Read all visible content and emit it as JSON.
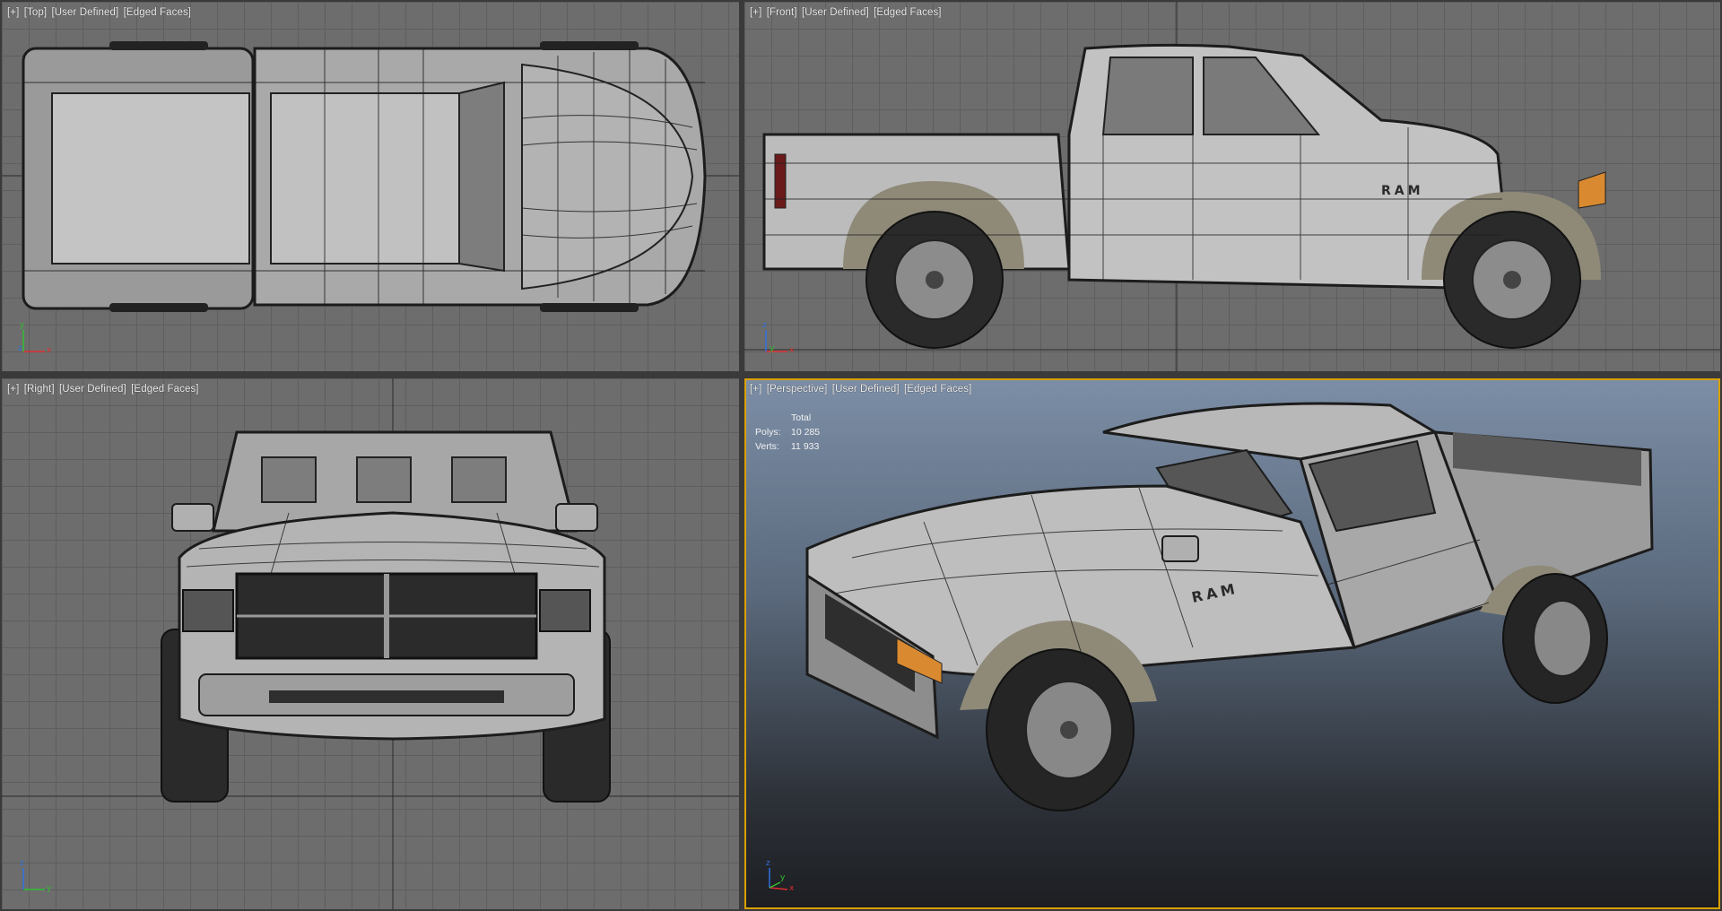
{
  "viewports": {
    "top": {
      "labels": [
        "[+]",
        "[Top]",
        "[User Defined]",
        "[Edged Faces]"
      ],
      "axis": {
        "horizontal": "x",
        "vertical": "y",
        "depth": "z"
      }
    },
    "front": {
      "labels": [
        "[+]",
        "[Front]",
        "[User Defined]",
        "[Edged Faces]"
      ],
      "axis": {
        "horizontal": "x",
        "vertical": "z",
        "depth": "y"
      }
    },
    "right": {
      "labels": [
        "[+]",
        "[Right]",
        "[User Defined]",
        "[Edged Faces]"
      ],
      "axis": {
        "horizontal": "y",
        "vertical": "z",
        "depth": ""
      }
    },
    "perspective": {
      "labels": [
        "[+]",
        "[Perspective]",
        "[User Defined]",
        "[Edged Faces]"
      ],
      "stats": {
        "header": "Total",
        "polys_label": "Polys:",
        "polys_value": "10 285",
        "verts_label": "Verts:",
        "verts_value": "11 933"
      },
      "axis": {
        "horizontal": "x",
        "vertical": "z",
        "depth": "y"
      }
    }
  },
  "model": {
    "badge_text": "RAM"
  },
  "colors": {
    "viewport_bg": "#6d6d6d",
    "grid_line": "#5e5e5e",
    "axis_x": "#e03030",
    "axis_y": "#30c030",
    "axis_z": "#3070e0",
    "active_border": "#d9a000",
    "body_fill": "#b8b8b8",
    "flare_fill": "#8f8a78"
  }
}
